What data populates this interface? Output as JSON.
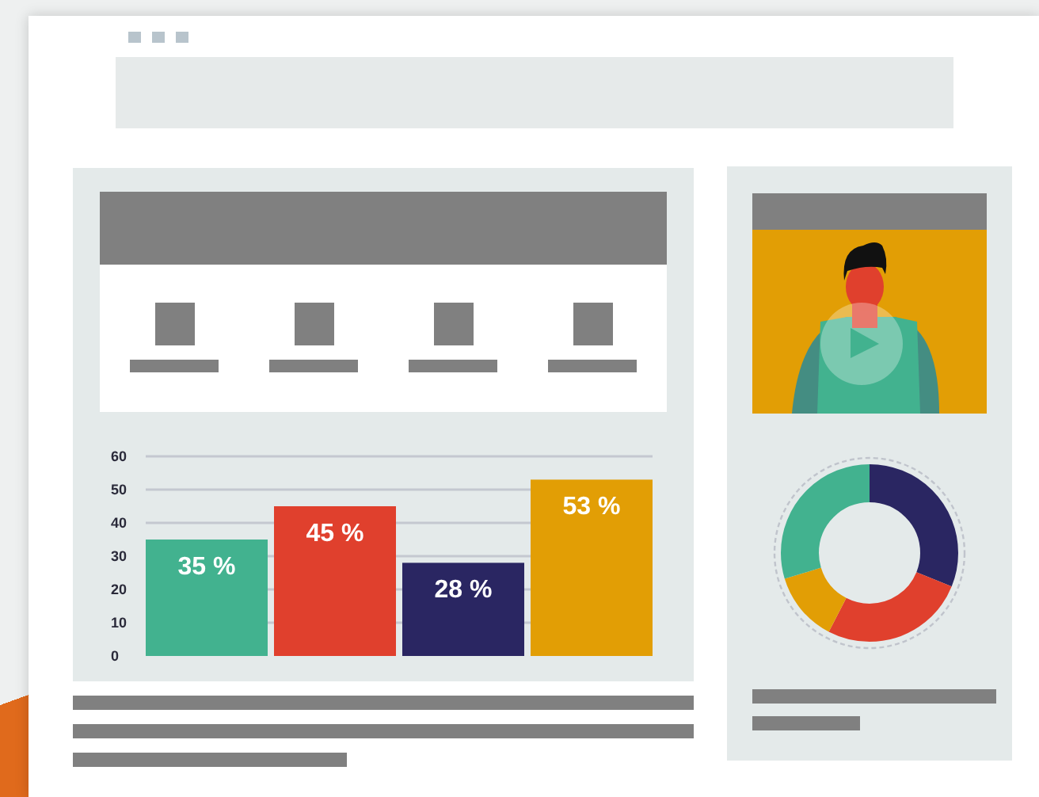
{
  "chart_data": {
    "type": "bar",
    "grid": true,
    "yticks": [
      0,
      10,
      20,
      30,
      40,
      50,
      60
    ],
    "ylim": [
      0,
      60
    ],
    "values": [
      35,
      45,
      28,
      53
    ],
    "colors": [
      "#42b28f",
      "#e0402d",
      "#2a2662",
      "#e29e05"
    ],
    "value_labels": [
      "35 %",
      "45 %",
      "28 %",
      "53 %"
    ]
  }
}
